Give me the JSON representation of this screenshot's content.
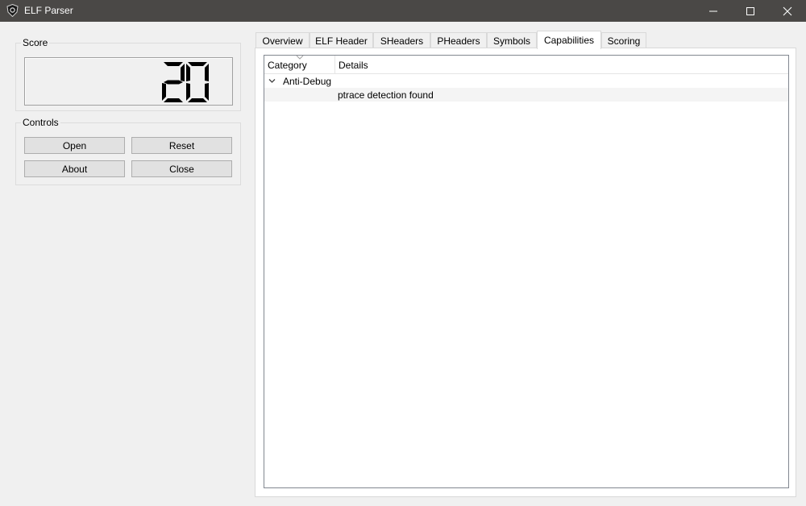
{
  "window": {
    "title": "ELF Parser",
    "icon": "app-shield-icon"
  },
  "score": {
    "title": "Score",
    "value": "20"
  },
  "controls": {
    "title": "Controls",
    "open_label": "Open",
    "reset_label": "Reset",
    "about_label": "About",
    "close_label": "Close"
  },
  "tabs": [
    {
      "label": "Overview"
    },
    {
      "label": "ELF Header"
    },
    {
      "label": "SHeaders"
    },
    {
      "label": "PHeaders"
    },
    {
      "label": "Symbols"
    },
    {
      "label": "Capabilities",
      "active": true
    },
    {
      "label": "Scoring"
    }
  ],
  "capabilities": {
    "columns": [
      "Category",
      "Details"
    ],
    "rows": [
      {
        "category": "Anti-Debug",
        "expanded": true,
        "children": [
          {
            "details": "ptrace detection found"
          }
        ]
      }
    ]
  },
  "colors": {
    "titlebar": "#4a4846",
    "window_bg": "#f0f0f0",
    "panel_bg": "#ffffff",
    "lcd_segment": "#000000"
  }
}
